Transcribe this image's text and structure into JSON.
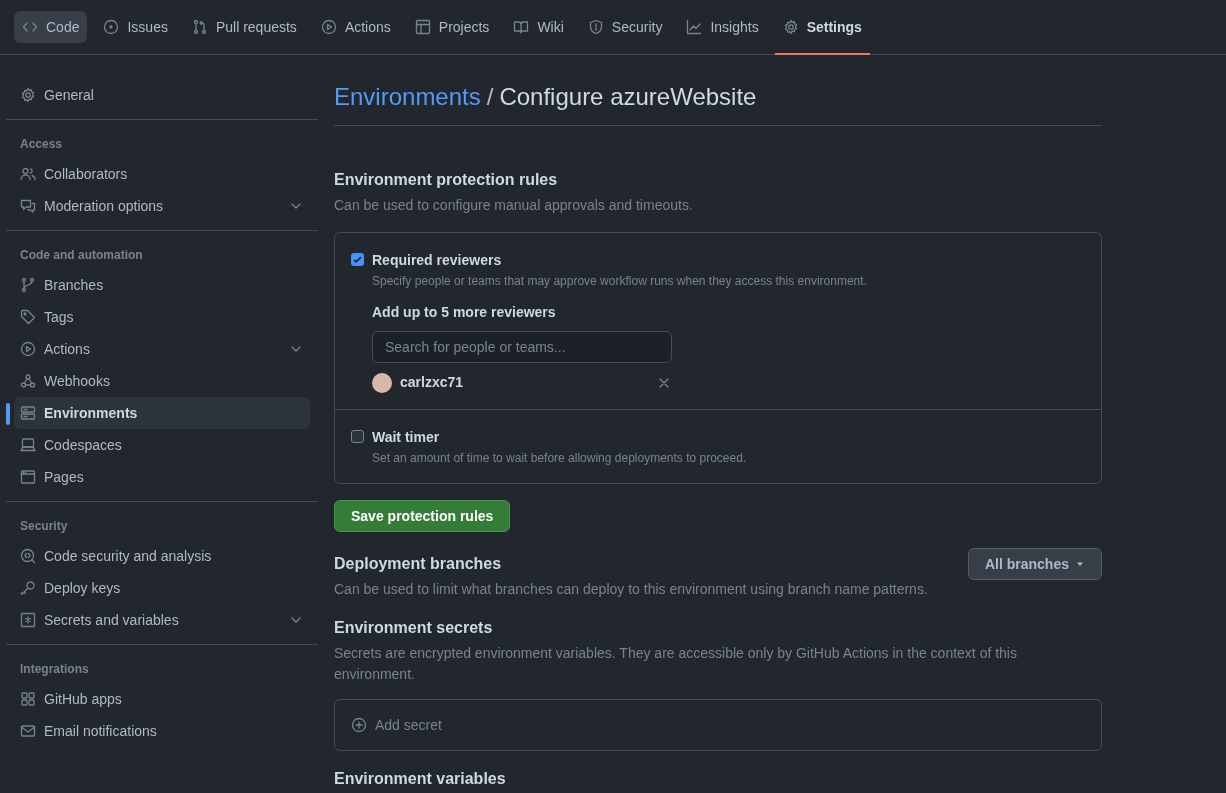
{
  "nav_tabs": [
    {
      "label": "Code",
      "selected": false,
      "hovered": true
    },
    {
      "label": "Issues",
      "selected": false,
      "hovered": false
    },
    {
      "label": "Pull requests",
      "selected": false,
      "hovered": false
    },
    {
      "label": "Actions",
      "selected": false,
      "hovered": false
    },
    {
      "label": "Projects",
      "selected": false,
      "hovered": false
    },
    {
      "label": "Wiki",
      "selected": false,
      "hovered": false
    },
    {
      "label": "Security",
      "selected": false,
      "hovered": false
    },
    {
      "label": "Insights",
      "selected": false,
      "hovered": false
    },
    {
      "label": "Settings",
      "selected": true,
      "hovered": false
    }
  ],
  "sidebar": {
    "sections": [
      {
        "items": [
          {
            "label": "General",
            "selected": false,
            "collapsible": false
          }
        ]
      },
      {
        "heading": "Access",
        "items": [
          {
            "label": "Collaborators",
            "selected": false,
            "collapsible": false
          },
          {
            "label": "Moderation options",
            "selected": false,
            "collapsible": true
          }
        ]
      },
      {
        "heading": "Code and automation",
        "items": [
          {
            "label": "Branches",
            "selected": false,
            "collapsible": false
          },
          {
            "label": "Tags",
            "selected": false,
            "collapsible": false
          },
          {
            "label": "Actions",
            "selected": false,
            "collapsible": true
          },
          {
            "label": "Webhooks",
            "selected": false,
            "collapsible": false
          },
          {
            "label": "Environments",
            "selected": true,
            "collapsible": false
          },
          {
            "label": "Codespaces",
            "selected": false,
            "collapsible": false
          },
          {
            "label": "Pages",
            "selected": false,
            "collapsible": false
          }
        ]
      },
      {
        "heading": "Security",
        "items": [
          {
            "label": "Code security and analysis",
            "selected": false,
            "collapsible": false
          },
          {
            "label": "Deploy keys",
            "selected": false,
            "collapsible": false
          },
          {
            "label": "Secrets and variables",
            "selected": false,
            "collapsible": true
          }
        ]
      },
      {
        "heading": "Integrations",
        "items": [
          {
            "label": "GitHub apps",
            "selected": false,
            "collapsible": false
          },
          {
            "label": "Email notifications",
            "selected": false,
            "collapsible": false
          }
        ]
      }
    ]
  },
  "breadcrumb": {
    "link": "Environments",
    "separator": "/",
    "current": "Configure azureWebsite"
  },
  "protection": {
    "title": "Environment protection rules",
    "description": "Can be used to configure manual approvals and timeouts.",
    "rules": [
      {
        "kind": "reviewers",
        "label": "Required reviewers",
        "checked": true,
        "description": "Specify people or teams that may approve workflow runs when they access this environment.",
        "subheading": "Add up to 5 more reviewers",
        "search": {
          "placeholder": "Search for people or teams..."
        },
        "reviewers": [
          {
            "name": "carlzxc71"
          }
        ]
      },
      {
        "kind": "timer",
        "label": "Wait timer",
        "checked": false,
        "description": "Set an amount of time to wait before allowing deployments to proceed."
      }
    ],
    "save_button": "Save protection rules"
  },
  "deployment_branches": {
    "title": "Deployment branches",
    "description": "Can be used to limit what branches can deploy to this environment using branch name patterns.",
    "dropdown": "All branches"
  },
  "secrets": {
    "title": "Environment secrets",
    "description": "Secrets are encrypted environment variables. They are accessible only by GitHub Actions in the context of this environment.",
    "add_button": "Add secret"
  },
  "variables": {
    "title": "Environment variables"
  }
}
